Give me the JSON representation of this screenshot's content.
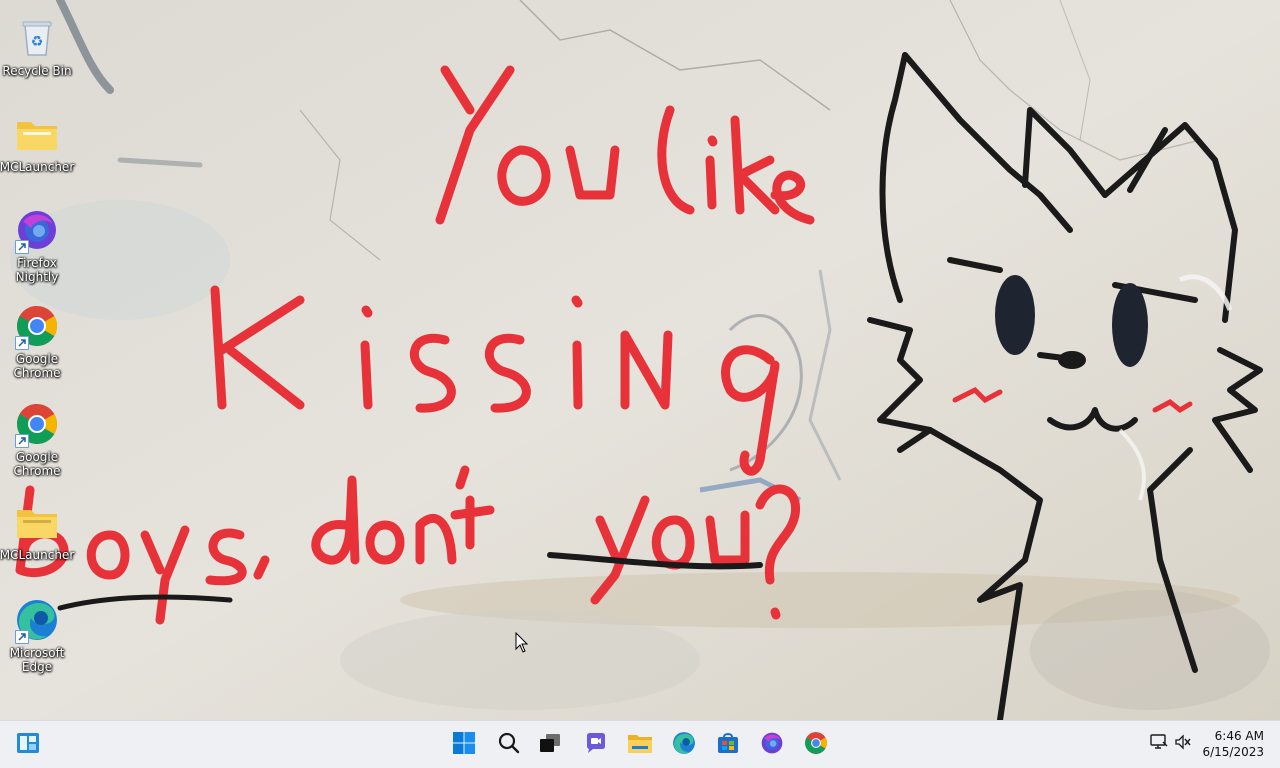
{
  "desktop": {
    "icons": [
      {
        "label": "Recycle Bin",
        "icon": "recycle-bin-icon"
      },
      {
        "label": "MCLauncher",
        "icon": "folder-icon"
      },
      {
        "label": "Firefox Nightly",
        "icon": "firefox-nightly-icon"
      },
      {
        "label": "Google Chrome",
        "icon": "chrome-icon"
      },
      {
        "label": "Google Chrome",
        "icon": "chrome-icon"
      },
      {
        "label": "MCLauncher",
        "icon": "folder-icon"
      },
      {
        "label": "Microsoft Edge",
        "icon": "edge-icon"
      }
    ]
  },
  "wallpaper": {
    "graffiti_lines": [
      "You like",
      "Kissing",
      "boys, don't",
      "you?"
    ]
  },
  "taskbar": {
    "apps": [
      {
        "icon": "start-icon"
      },
      {
        "icon": "search-icon"
      },
      {
        "icon": "task-view-icon"
      },
      {
        "icon": "chat-icon"
      },
      {
        "icon": "file-explorer-icon"
      },
      {
        "icon": "edge-icon"
      },
      {
        "icon": "microsoft-store-icon"
      },
      {
        "icon": "firefox-nightly-icon"
      },
      {
        "icon": "chrome-icon"
      }
    ],
    "clock": {
      "time": "6:46 AM",
      "date": "6/15/2023"
    }
  },
  "colors": {
    "graffiti_red": "#e8323a",
    "graffiti_black": "#1a1a1a",
    "taskbar_bg": "#eef0f3",
    "accent": "#0067c0"
  }
}
